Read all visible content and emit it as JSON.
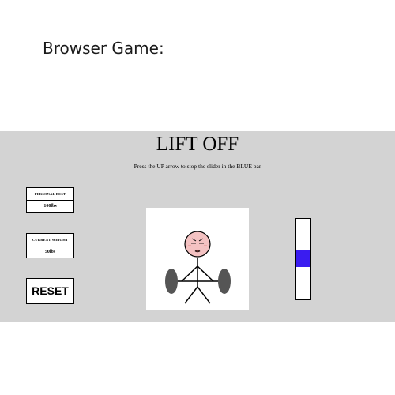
{
  "page": {
    "heading": "Browser Game:"
  },
  "game": {
    "title": "LIFT OFF",
    "instructions": "Press the UP arrow to stop the slider in the BLUE bar",
    "personal_best": {
      "label": "PERSONAL BEST",
      "value": "100lbs"
    },
    "current_weight": {
      "label": "CURRENT WEIGHT",
      "value": "50lbs"
    },
    "reset_label": "RESET",
    "colors": {
      "background": "#d3d3d3",
      "target_zone": "#3a1cf0",
      "face": "#f4c2c2",
      "weight_plate": "#555555"
    },
    "lifter": {
      "expression": "straining-face",
      "barbell_icon": "barbell-icon"
    },
    "meter": {
      "target_zone_start": 0.39,
      "target_zone_end": 0.6,
      "slider_position": 0.62
    }
  }
}
